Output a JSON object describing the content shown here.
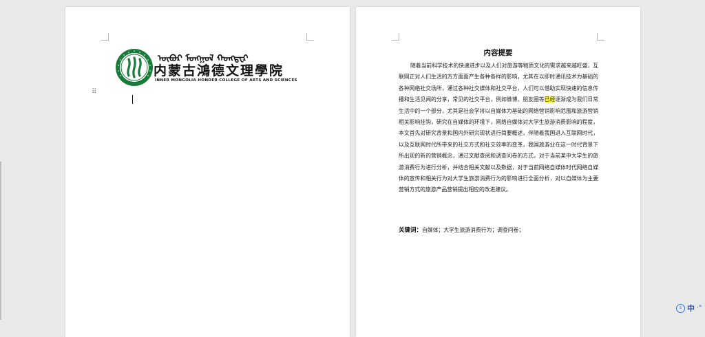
{
  "logo": {
    "mongolian_text": "ᠥᠪᠥᠷ ᠮᠣᠩᠭᠣᠯ ᠬᠣᠩᠳᠧᠷ",
    "college_name_cn": "内蒙古鴻德文理學院",
    "college_name_en": "INNER MONGOLIA HONDER COLLEGE OF ARTS AND SCIENCES",
    "seal_color": "#1a7a3a"
  },
  "abstract": {
    "title": "内容提要",
    "body_before_highlight": "随着当前科学技术的快速进步以及人们对旅游等物质文化的需求越来越旺盛，互联网正对人们生活的方方面面产生各种各样的影响，尤其在以即时通讯技术为基础的各种网络社交场所，通过各种社交媒体和社交平台，人们可以借助实现快速的信息传播和生活见闻的分享，常见的社交平台，例如微博、朋友圈等",
    "highlight": "已经",
    "body_after_highlight": "逐渐成为我们日常生活中的一个部分，尤其是社会学将以自媒体为基础的网络营销影响范围和旅游营销相关影响挂钩，研究在自媒体的环境下，网络自媒体对大学生旅游消费影响的程度，本文首先对研究背景和国内外研究现状进行简要概述，伴随着我国进入互联网时代，以及互联网时代所带来的社交方式和社交效率的变革，我国旅游业在这一时代背景下所出现的新的营销概念，通过文献查阅和调查问卷的方式，对于当前某中大学生的旅游消费行为进行分析，并结合相关文献以及数据，对于当前网络自媒体时代网络自媒体的宣传和相关行为对大学生旅游消费行为的影响进行全面分析，对以自媒体为主要营销方式的旅游产品营销提出相应的改进建议。",
    "keywords_label": "关键词：",
    "keywords_value": "自媒体；大学生旅游消费行为；调查问卷；",
    "highlight_color": "#ffff3b"
  },
  "ime": {
    "logo_label": "S",
    "language": "中",
    "more": "·°"
  },
  "icons": {
    "drag_handle": "drag-handle-icon",
    "seal": "college-seal-icon"
  }
}
